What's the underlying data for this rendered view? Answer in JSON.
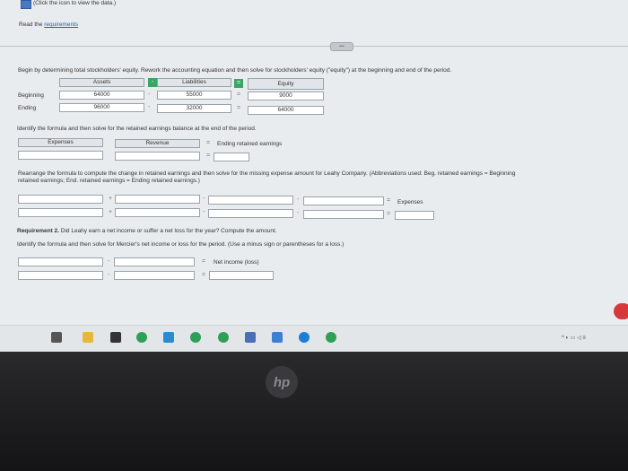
{
  "top_note": "(Click the icon to view the data.)",
  "read_prefix": "Read the",
  "read_link": "requirements",
  "pill": "•••",
  "instruction1": "Begin by determining total stockholders' equity. Rework the accounting equation and then solve for stockholders' equity (\"equity\") at the beginning and end of the period.",
  "equation": {
    "headers": {
      "assets": "Assets",
      "liabilities": "Liabilities",
      "equity": "Equity"
    },
    "minus": "-",
    "equals": "=",
    "rows": [
      {
        "label": "Beginning",
        "assets": "64000",
        "liabilities": "55000",
        "equity": "9000"
      },
      {
        "label": "Ending",
        "assets": "96000",
        "liabilities": "32000",
        "equity": "64000"
      }
    ]
  },
  "instruction2": "Identify the formula and then solve for the retained earnings balance at the end of the period.",
  "retained": {
    "expenses": "Expenses",
    "revenue": "Revenue",
    "result": "Ending retained earnings",
    "equals": "="
  },
  "instruction3_line1": "Rearrange the formula to compute the change in retained earnings and then solve for the missing expense amount for Leahy Company. (Abbreviations used: Beg. retained earnings = Beginning",
  "instruction3_line2": "retained earnings; End. retained earnings = Ending retained earnings.)",
  "expense_formula": {
    "plus": "+",
    "minus": "-",
    "equals": "=",
    "result": "Expenses"
  },
  "req2_bold": "Requirement 2.",
  "req2_text": "Did Leahy earn a net income or suffer a net loss for the year? Compute the amount.",
  "instruction4": "Identify the formula and then solve for Mercier's net income or loss for the period. (Use a minus sign or parentheses for a loss.)",
  "net_income": {
    "minus": "-",
    "equals": "=",
    "result": "Net income (loss)"
  },
  "tray_text": "^  ◐  ▭  ◁  ≡",
  "hp": "hp",
  "colors": {
    "link": "#2a5db0",
    "accent_green": "#3aa564",
    "red_button": "#d7393b"
  },
  "taskbar_icons": [
    "start-icon",
    "file-explorer-icon",
    "app-icon",
    "chrome-icon",
    "photos-icon",
    "chrome-icon",
    "chrome-icon",
    "store-icon",
    "mail-icon",
    "edge-icon",
    "chrome-icon"
  ]
}
